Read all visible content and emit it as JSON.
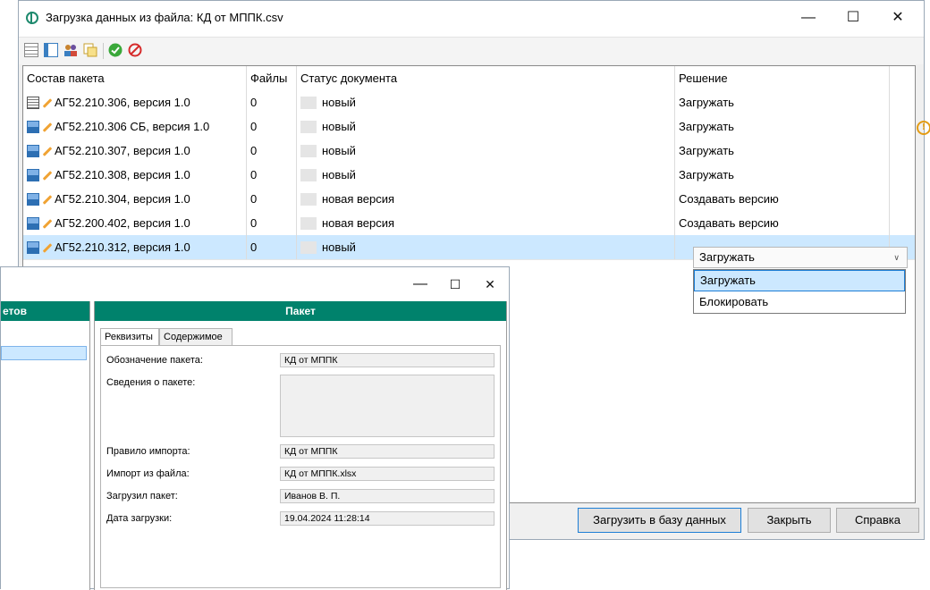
{
  "main_window": {
    "title": "Загрузка данных из файла: КД от МППК.csv",
    "controls": {
      "minimize": "—",
      "maximize": "☐",
      "close": "✕"
    },
    "toolbar_icons": [
      "list-icon",
      "tree-icon",
      "users-icon",
      "copy-icon",
      "check-icon",
      "cancel-icon"
    ]
  },
  "grid": {
    "columns": [
      "Состав пакета",
      "Файлы",
      "Статус документа",
      "Решение"
    ],
    "rows": [
      {
        "name": "АГ52.210.306, версия 1.0",
        "files": "0",
        "status": "новый",
        "decision": "Загружать",
        "icon": "document-icon"
      },
      {
        "name": "АГ52.210.306 СБ, версия 1.0",
        "files": "0",
        "status": "новый",
        "decision": "Загружать",
        "icon": "assembly-icon",
        "warning": "!"
      },
      {
        "name": "АГ52.210.307, версия 1.0",
        "files": "0",
        "status": "новый",
        "decision": "Загружать",
        "icon": "assembly-icon"
      },
      {
        "name": "АГ52.210.308, версия 1.0",
        "files": "0",
        "status": "новый",
        "decision": "Загружать",
        "icon": "assembly-icon"
      },
      {
        "name": "АГ52.210.304, версия 1.0",
        "files": "0",
        "status": "новая версия",
        "decision": "Создавать версию",
        "icon": "assembly-icon"
      },
      {
        "name": "АГ52.200.402, версия 1.0",
        "files": "0",
        "status": "новая версия",
        "decision": "Создавать версию",
        "icon": "assembly-icon"
      },
      {
        "name": "АГ52.210.312, версия 1.0",
        "files": "0",
        "status": "новый",
        "decision": "Загружать",
        "icon": "assembly-icon",
        "selected": true
      }
    ]
  },
  "dropdown": {
    "value": "Загружать",
    "options": [
      "Загружать",
      "Блокировать"
    ]
  },
  "buttons": {
    "load": "Загрузить в базу данных",
    "close": "Закрыть",
    "help": "Справка"
  },
  "sub_window": {
    "controls": {
      "minimize": "—",
      "maximize": "☐",
      "close": "✕"
    },
    "left_header": "етов",
    "panel_header": "Пакет",
    "tabs": [
      "Реквизиты",
      "Содержимое"
    ],
    "fields": [
      {
        "label": "Обозначение пакета:",
        "value": "КД от МППК"
      },
      {
        "label": "Сведения о пакете:",
        "value": ""
      },
      {
        "label": "Правило импорта:",
        "value": "КД от МППК"
      },
      {
        "label": "Импорт из файла:",
        "value": "КД от МППК.xlsx"
      },
      {
        "label": "Загрузил пакет:",
        "value": "Иванов В. П."
      },
      {
        "label": "Дата загрузки:",
        "value": "19.04.2024 11:28:14"
      }
    ]
  },
  "colors": {
    "header_green": "#00826c",
    "selection": "#cce8ff",
    "warning": "#e39c15"
  }
}
